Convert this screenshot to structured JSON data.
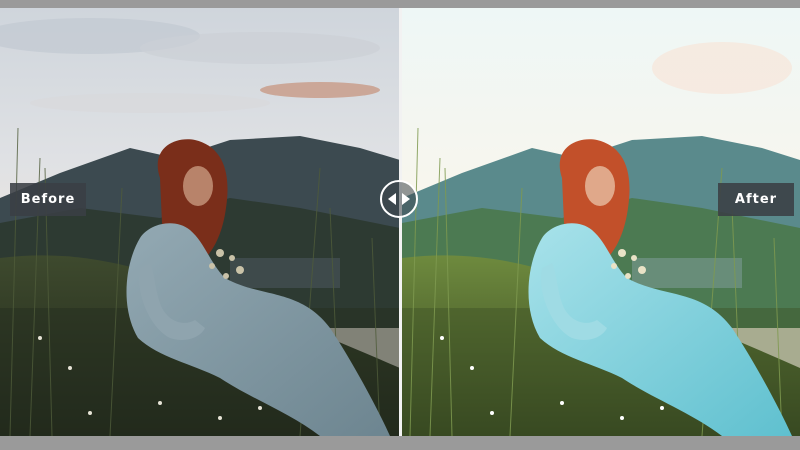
{
  "labels": {
    "before": "Before",
    "after": "After"
  },
  "comparison": {
    "divider_fraction": 0.5
  },
  "colors": {
    "frame": "#9a9a9a",
    "label_bg": "#3a3f44",
    "label_text": "#ffffff",
    "divider": "#f2f2f2"
  },
  "icons": {
    "handle": "left-right-arrows-icon"
  }
}
